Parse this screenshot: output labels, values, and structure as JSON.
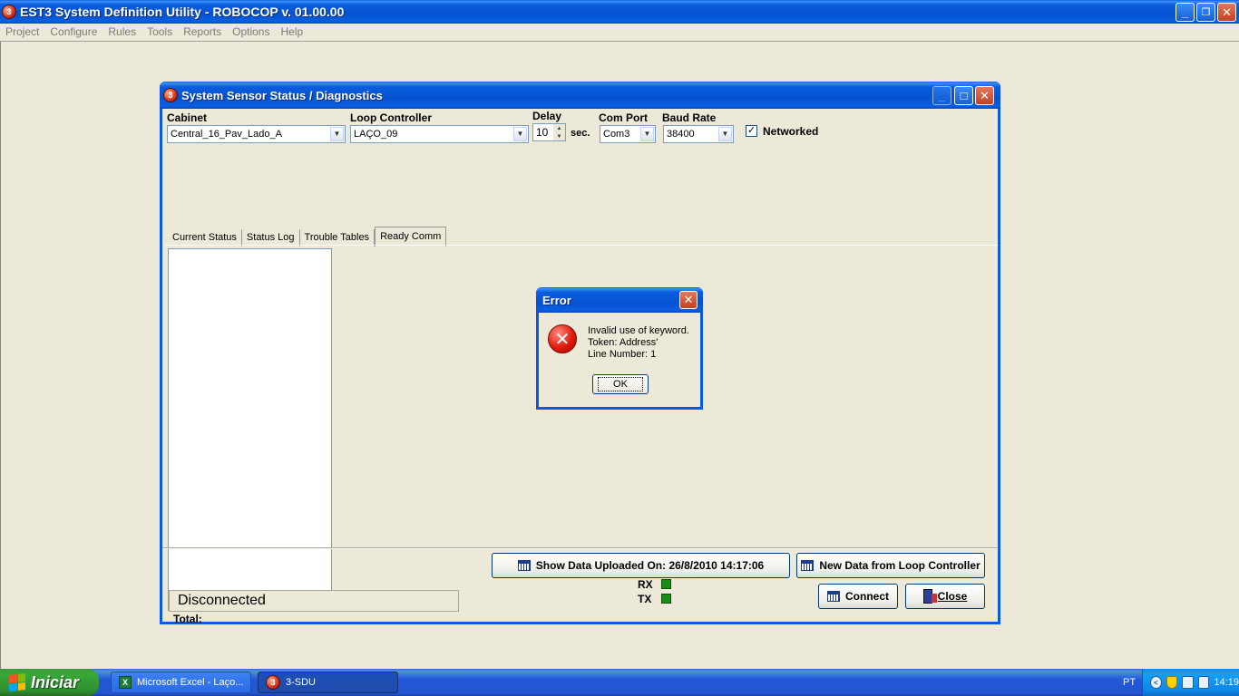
{
  "app": {
    "title": "EST3 System Definition Utility - ROBOCOP v. 01.00.00",
    "icon_text": "3",
    "window_buttons": {
      "minimize": "_",
      "restore": "❐",
      "close": "✕"
    }
  },
  "menu": {
    "items": [
      "Project",
      "Configure",
      "Rules",
      "Tools",
      "Reports",
      "Options",
      "Help"
    ]
  },
  "child_window": {
    "title": "System Sensor Status / Diagnostics",
    "buttons": {
      "minimize": "_",
      "maximize": "□",
      "close": "✕"
    },
    "fields": {
      "cabinet_label": "Cabinet",
      "cabinet_value": "Central_16_Pav_Lado_A",
      "loop_label": "Loop Controller",
      "loop_value": "LAÇO_09",
      "delay_label": "Delay",
      "delay_value": "10",
      "delay_unit": "sec.",
      "com_label": "Com Port",
      "com_value": "Com3",
      "baud_label": "Baud Rate",
      "baud_value": "38400",
      "networked_label": "Networked",
      "networked_checked": "✓"
    },
    "tabs": [
      {
        "label": "Current Status",
        "active": false
      },
      {
        "label": "Status Log",
        "active": false
      },
      {
        "label": "Trouble Tables",
        "active": false
      },
      {
        "label": "Ready Comm",
        "active": true
      }
    ],
    "list": {
      "total_label": "Total:"
    },
    "buttons_bottom": {
      "show_data": "Show Data Uploaded On: 26/8/2010 14:17:06",
      "new_data": "New Data from Loop Controller",
      "connect": "Connect",
      "close": "Close"
    },
    "status": "Disconnected",
    "rx_label": "RX",
    "tx_label": "TX",
    "led_color": "#1a8a1a"
  },
  "error_dialog": {
    "title": "Error",
    "close": "✕",
    "icon": "✕",
    "lines": [
      "Invalid use of keyword.",
      "Token: Address'",
      "Line Number: 1"
    ],
    "ok_label": "OK"
  },
  "taskbar": {
    "start_label": "Iniciar",
    "tasks": [
      {
        "label": "Microsoft Excel - Laço...",
        "icon": "X"
      },
      {
        "label": "3-SDU",
        "icon": "3"
      }
    ],
    "language": "PT",
    "clock": "14:19"
  }
}
